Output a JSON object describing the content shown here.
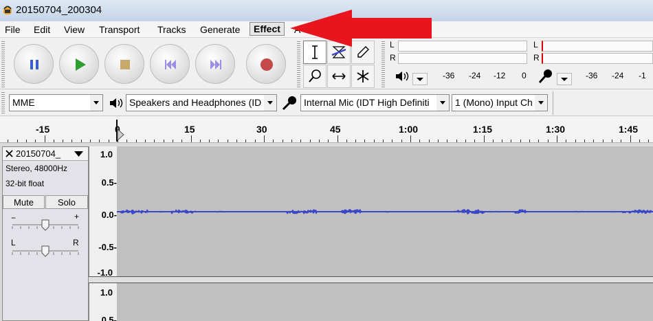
{
  "window": {
    "title": "20150704_200304"
  },
  "menu": {
    "items": [
      "File",
      "Edit",
      "View",
      "Transport",
      "Tracks",
      "Generate",
      "Effect",
      "A"
    ]
  },
  "colors": {
    "arrow": "#e8141e",
    "waveform": "#3c46c8",
    "record": "#c44a4a",
    "play": "#2e9e2e",
    "pause": "#3a5fcd"
  },
  "meters": {
    "playback_scale": [
      "-36",
      "-24",
      "-12",
      "0"
    ],
    "record_scale": [
      "-36",
      "-24",
      "-1"
    ],
    "left_letter": "L",
    "right_letter": "R"
  },
  "devices": {
    "host": "MME",
    "output": "Speakers and Headphones (ID",
    "input": "Internal Mic (IDT High Definiti",
    "channels": "1 (Mono) Input Ch"
  },
  "timeline": {
    "labels": [
      "-15",
      "0",
      "15",
      "30",
      "45",
      "1:00",
      "1:15",
      "1:30",
      "1:45"
    ]
  },
  "track": {
    "name": "20150704_",
    "format": "Stereo, 48000Hz",
    "bitdepth": "32-bit float",
    "mute": "Mute",
    "solo": "Solo",
    "gain_minus": "−",
    "gain_plus": "+",
    "pan_left": "L",
    "pan_right": "R",
    "ruler1": [
      "1.0",
      "0.5-",
      "0.0-",
      "-0.5-",
      "-1.0"
    ],
    "ruler2": [
      "1.0",
      "0.5-"
    ]
  }
}
